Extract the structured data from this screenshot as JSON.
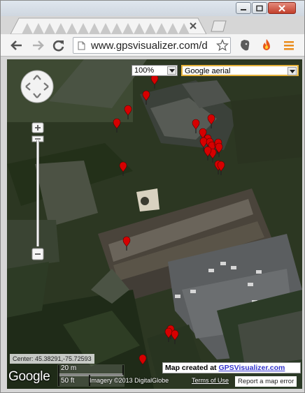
{
  "browser": {
    "tab_close_icon": "close-icon",
    "url": "www.gpsvisualizer.com/d",
    "nav": {
      "back_icon": "back-arrow-icon",
      "forward_icon": "forward-arrow-icon",
      "reload_icon": "reload-icon"
    },
    "extensions": [
      "evernote-icon",
      "fire-icon",
      "menu-icon"
    ]
  },
  "map": {
    "zoom_select": {
      "value": "100%"
    },
    "maptype_select": {
      "value": "Google aerial"
    },
    "center_readout": "Center: 45.38291,-75.72593",
    "scale": {
      "metric": "20 m",
      "imperial": "50 ft"
    },
    "google_logo": "Google",
    "imagery_attribution": "Imagery ©2013 DigitalGlobe",
    "terms_link": "Terms of Use",
    "report_link": "Report a map error",
    "credit": {
      "prefix": "Map created at ",
      "link": "GPSVisualizer.com"
    },
    "colors": {
      "pin": "#d60000",
      "credit_link": "#3333cc",
      "select_highlight": "#e6b23a"
    }
  }
}
